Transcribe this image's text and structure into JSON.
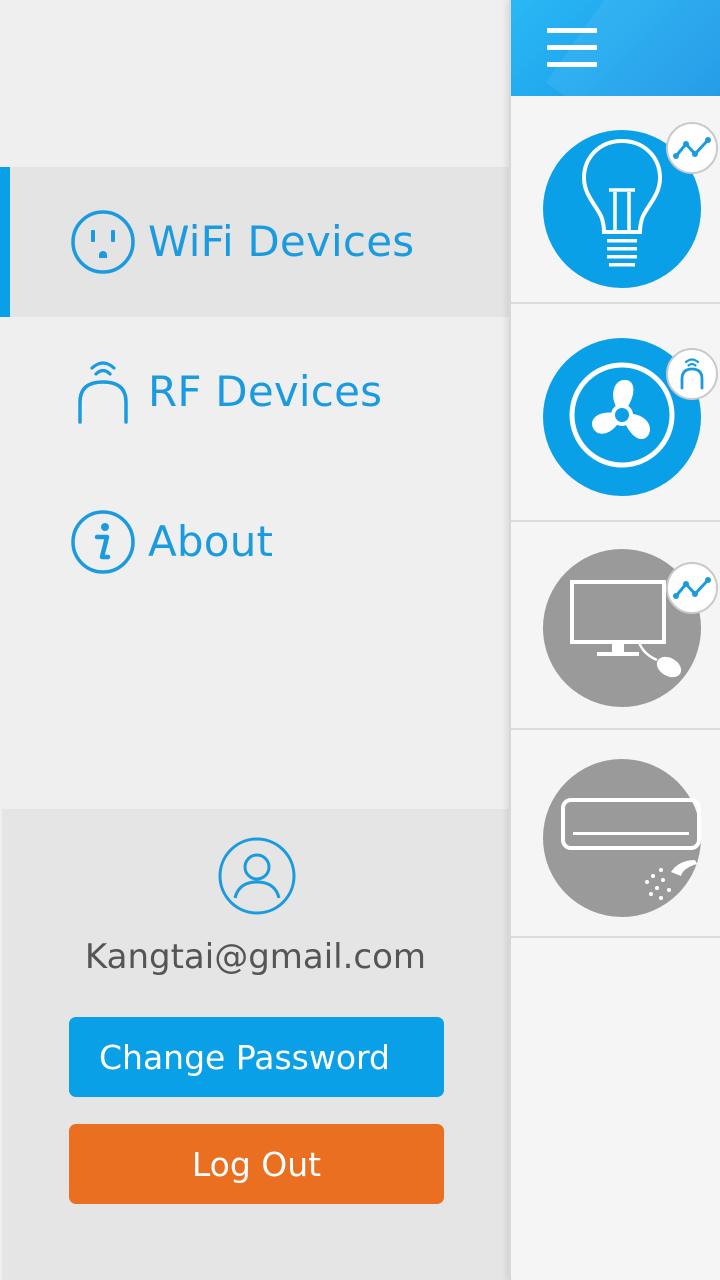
{
  "menu": {
    "items": [
      {
        "label": "WiFi Devices",
        "icon": "outlet-icon",
        "active": true
      },
      {
        "label": "RF Devices",
        "icon": "rf-signal-icon",
        "active": false
      },
      {
        "label": "About",
        "icon": "info-icon",
        "active": false
      }
    ]
  },
  "account": {
    "email": "Kangtai@gmail.com",
    "change_password_label": "Change Password",
    "logout_label": "Log Out"
  },
  "main": {
    "menu_icon": "hamburger-icon",
    "devices": [
      {
        "icon": "light-bulb-icon",
        "status": "on",
        "badge": "wifi-chart-icon"
      },
      {
        "icon": "fan-icon",
        "status": "on",
        "badge": "rf-signal-icon"
      },
      {
        "icon": "tv-monitor-icon",
        "status": "off",
        "badge": "wifi-chart-icon"
      },
      {
        "icon": "air-conditioner-icon",
        "status": "off",
        "badge": "none"
      }
    ]
  },
  "colors": {
    "accent_blue": "#0aa0e8",
    "logout_orange": "#ea6f21",
    "device_on": "#0aa0e8",
    "device_off": "#9a9a9a",
    "drawer_bg": "#efefef"
  }
}
